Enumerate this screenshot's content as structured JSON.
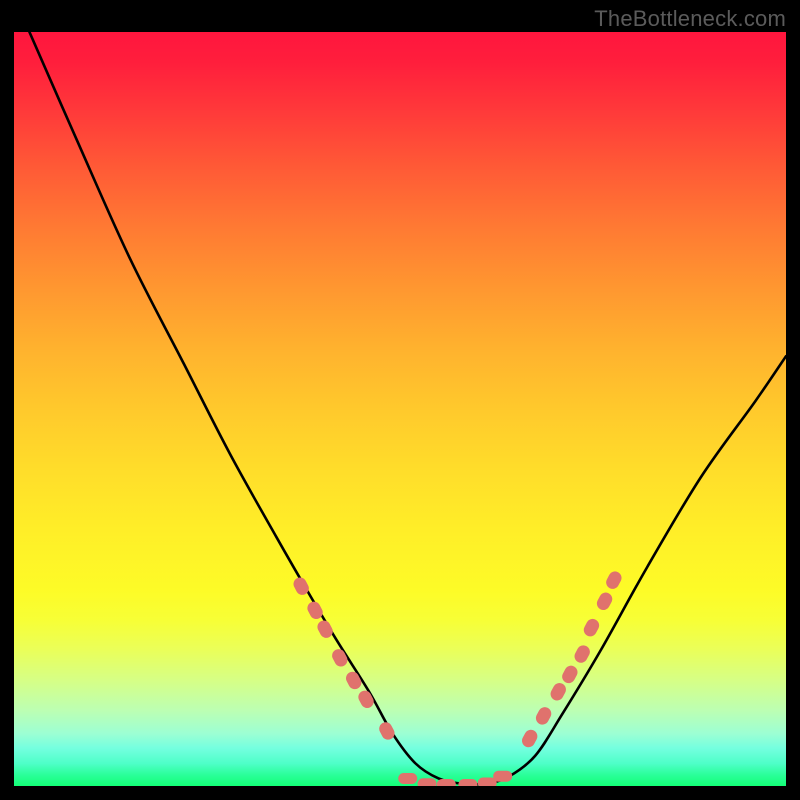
{
  "watermark": "TheBottleneck.com",
  "chart_data": {
    "type": "line",
    "title": "",
    "xlabel": "",
    "ylabel": "",
    "xlim": [
      0,
      100
    ],
    "ylim": [
      0,
      100
    ],
    "grid": false,
    "series": [
      {
        "name": "bottleneck-curve",
        "color": "#000000",
        "x": [
          2,
          8,
          15,
          22,
          28,
          34,
          38.5,
          42,
          46,
          49,
          52,
          55,
          58,
          61,
          64,
          67.5,
          71,
          76,
          82,
          89,
          96,
          100
        ],
        "y": [
          100,
          86,
          70,
          56,
          44,
          33,
          25,
          19,
          12.5,
          7,
          3,
          1,
          0.3,
          0.3,
          1.2,
          4,
          9.5,
          18,
          29,
          41,
          51,
          57
        ]
      }
    ],
    "markers": [
      {
        "name": "dots-left-branch",
        "color": "#e0726d",
        "shape": "pill",
        "x": [
          37.2,
          39.0,
          40.3,
          42.2,
          44.0,
          45.6,
          48.3
        ],
        "y": [
          26.5,
          23.3,
          20.8,
          17.0,
          14.0,
          11.5,
          7.3
        ]
      },
      {
        "name": "dots-valley",
        "color": "#e0726d",
        "shape": "pill",
        "x": [
          51.0,
          53.5,
          56.0,
          58.8,
          61.3,
          63.3
        ],
        "y": [
          1.0,
          0.3,
          0.2,
          0.2,
          0.4,
          1.3
        ]
      },
      {
        "name": "dots-right-branch",
        "color": "#e0726d",
        "shape": "pill",
        "x": [
          66.8,
          68.6,
          70.5,
          72.0,
          73.6,
          74.8,
          76.5,
          77.7
        ],
        "y": [
          6.3,
          9.3,
          12.5,
          14.8,
          17.5,
          21.0,
          24.5,
          27.3
        ]
      }
    ],
    "background_gradient": {
      "top": "#ff163e",
      "mid": "#ffee28",
      "bottom": "#13ff76"
    }
  }
}
